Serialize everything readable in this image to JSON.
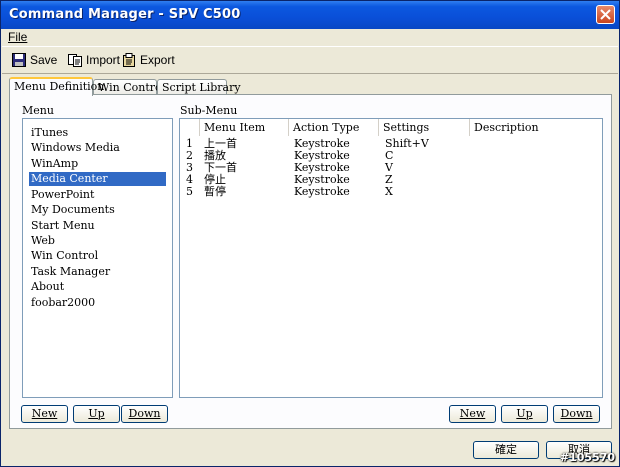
{
  "window": {
    "title": "Command Manager - SPV C500"
  },
  "menubar": {
    "file": "File"
  },
  "toolbar": {
    "save": "Save",
    "import": "Import",
    "export": "Export"
  },
  "tabs": [
    "Menu Definition",
    "Win Control",
    "Script Library"
  ],
  "menu": {
    "label": "Menu",
    "items": [
      "iTunes",
      "Windows Media",
      "WinAmp",
      "Media Center",
      "PowerPoint",
      "My Documents",
      "Start Menu",
      "Web",
      "Win Control",
      "Task Manager",
      "About",
      "foobar2000"
    ],
    "selected": "Media Center",
    "buttons": {
      "new": "New",
      "up": "Up",
      "down": "Down"
    }
  },
  "submenu": {
    "label": "Sub-Menu",
    "columns": [
      "Menu Item",
      "Action Type",
      "Settings",
      "Description"
    ],
    "rows": [
      {
        "num": "1",
        "item": "上一首",
        "action": "Keystroke",
        "settings": "Shift+V",
        "description": ""
      },
      {
        "num": "2",
        "item": "播放",
        "action": "Keystroke",
        "settings": "C",
        "description": ""
      },
      {
        "num": "3",
        "item": "下一首",
        "action": "Keystroke",
        "settings": "V",
        "description": ""
      },
      {
        "num": "4",
        "item": "停止",
        "action": "Keystroke",
        "settings": "Z",
        "description": ""
      },
      {
        "num": "5",
        "item": "暫停",
        "action": "Keystroke",
        "settings": "X",
        "description": ""
      }
    ],
    "buttons": {
      "new": "New",
      "up": "Up",
      "down": "Down"
    }
  },
  "dialog_buttons": {
    "ok": "確定",
    "cancel": "取消"
  },
  "watermark": "#105570",
  "colors": {
    "title_bar": "#0a4fd8",
    "selection": "#316ac5",
    "active_tab_accent": "#ffc73c"
  }
}
